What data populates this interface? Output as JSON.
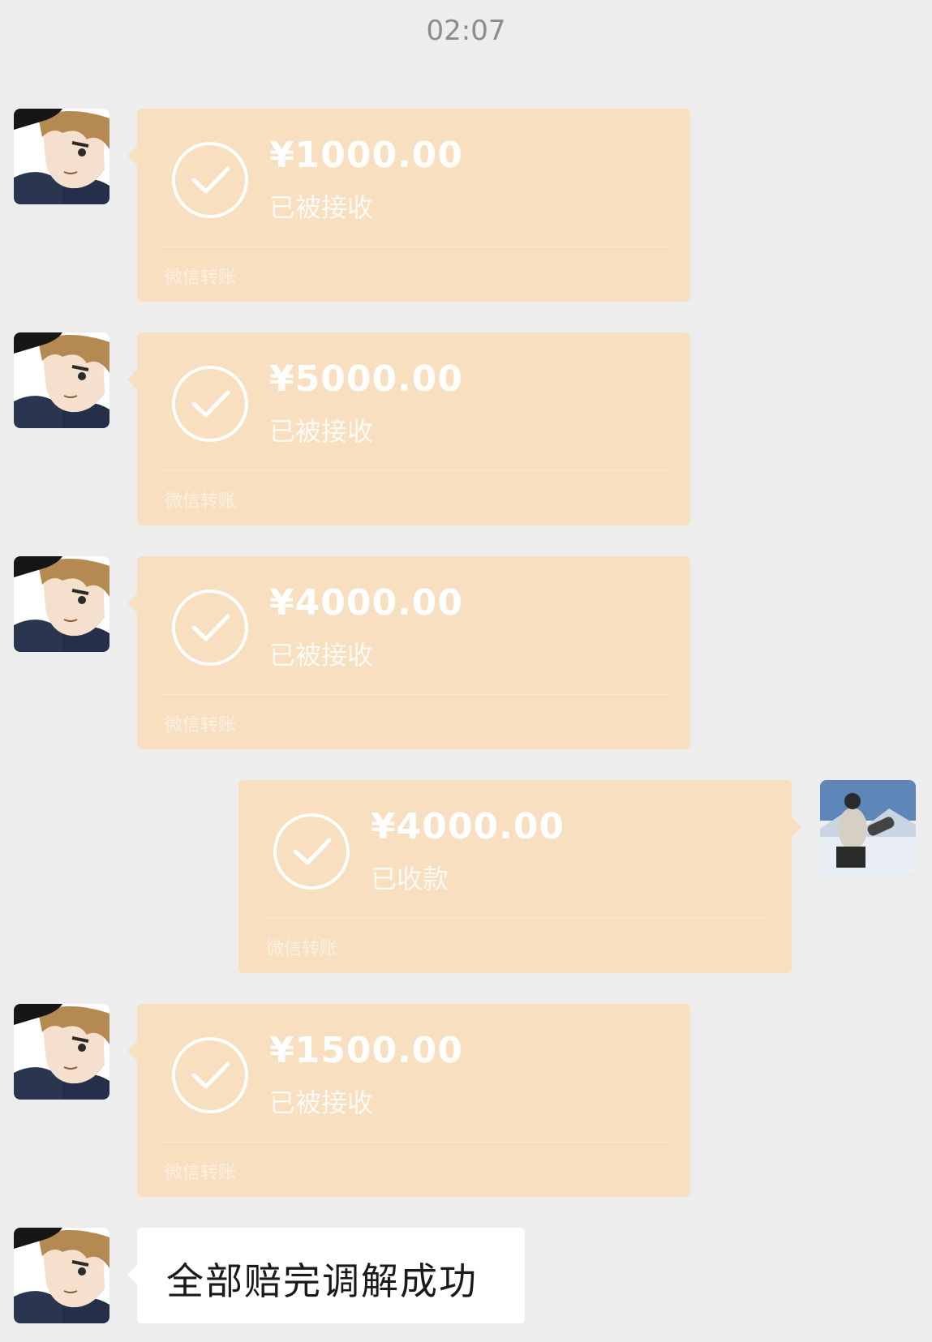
{
  "chat": {
    "timestamp": "02:07",
    "transfers": [
      {
        "amount": "¥1000.00",
        "status": "已被接收",
        "footer": "微信转账",
        "side": "left"
      },
      {
        "amount": "¥5000.00",
        "status": "已被接收",
        "footer": "微信转账",
        "side": "left"
      },
      {
        "amount": "¥4000.00",
        "status": "已被接收",
        "footer": "微信转账",
        "side": "left"
      },
      {
        "amount": "¥4000.00",
        "status": "已收款",
        "footer": "微信转账",
        "side": "right"
      },
      {
        "amount": "¥1500.00",
        "status": "已被接收",
        "footer": "微信转账",
        "side": "left"
      }
    ],
    "last_message": {
      "text": "全部赔完调解成功",
      "side": "left"
    }
  },
  "colors": {
    "background": "#ededed",
    "transfer_bubble": "#f7dfbf",
    "text_bubble": "#ffffff"
  },
  "icons": {
    "check": "check-circle-icon",
    "avatar_left": "anime-avatar",
    "avatar_right": "snowboarder-avatar"
  }
}
